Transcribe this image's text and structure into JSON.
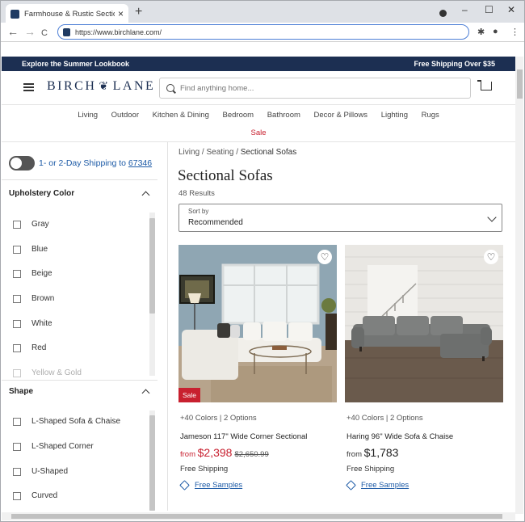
{
  "browser": {
    "tab_title": "Farmhouse & Rustic Sectional Sofas",
    "tab_close": "×",
    "new_tab": "+",
    "url": "https://www.birchlane.com/",
    "back": "←",
    "forward": "→",
    "reload": "C",
    "window_minimize": "–",
    "window_maximize": "☐",
    "window_close": "✕",
    "extensions_icon": "puzzle-icon",
    "menu_icon": "⋮"
  },
  "promo": {
    "left": "Explore the Summer Lookbook",
    "right": "Free Shipping Over $35"
  },
  "header": {
    "logo_left": "BIRCH",
    "logo_right": "LANE",
    "search_placeholder": "Find anything home..."
  },
  "categories": [
    "Living",
    "Outdoor",
    "Kitchen & Dining",
    "Bedroom",
    "Bathroom",
    "Decor & Pillows",
    "Lighting",
    "Rugs"
  ],
  "sale_link": "Sale",
  "shipping": {
    "text": "1- or 2-Day Shipping to",
    "zip": "67346"
  },
  "filters": {
    "upholstery": {
      "title": "Upholstery Color",
      "options": [
        "Gray",
        "Blue",
        "Beige",
        "Brown",
        "White",
        "Red",
        "Yellow & Gold"
      ]
    },
    "shape": {
      "title": "Shape",
      "options": [
        "L-Shaped Sofa & Chaise",
        "L-Shaped Corner",
        "U-Shaped",
        "Curved"
      ]
    }
  },
  "breadcrumb": {
    "items": [
      "Living",
      "Seating",
      "Sectional Sofas"
    ],
    "separator": "/"
  },
  "page_title": "Sectional Sofas",
  "results": "48 Results",
  "sort": {
    "label": "Sort by",
    "value": "Recommended"
  },
  "products": [
    {
      "meta": "+40 Colors | 2 Options",
      "name": "Jameson 117\" Wide Corner Sectional",
      "from": "from",
      "price": "$2,398",
      "was": "$2,650.99",
      "badge": "Sale",
      "shipping": "Free Shipping",
      "samples": "Free Samples"
    },
    {
      "meta": "+40 Colors | 2 Options",
      "name": "Haring 96\" Wide Sofa & Chaise",
      "from": "from",
      "price": "$1,783",
      "shipping": "Free Shipping",
      "samples": "Free Samples"
    }
  ],
  "colors": {
    "navy": "#1c2f52",
    "sale_red": "#c8202f",
    "link_blue": "#1c5aa6"
  }
}
